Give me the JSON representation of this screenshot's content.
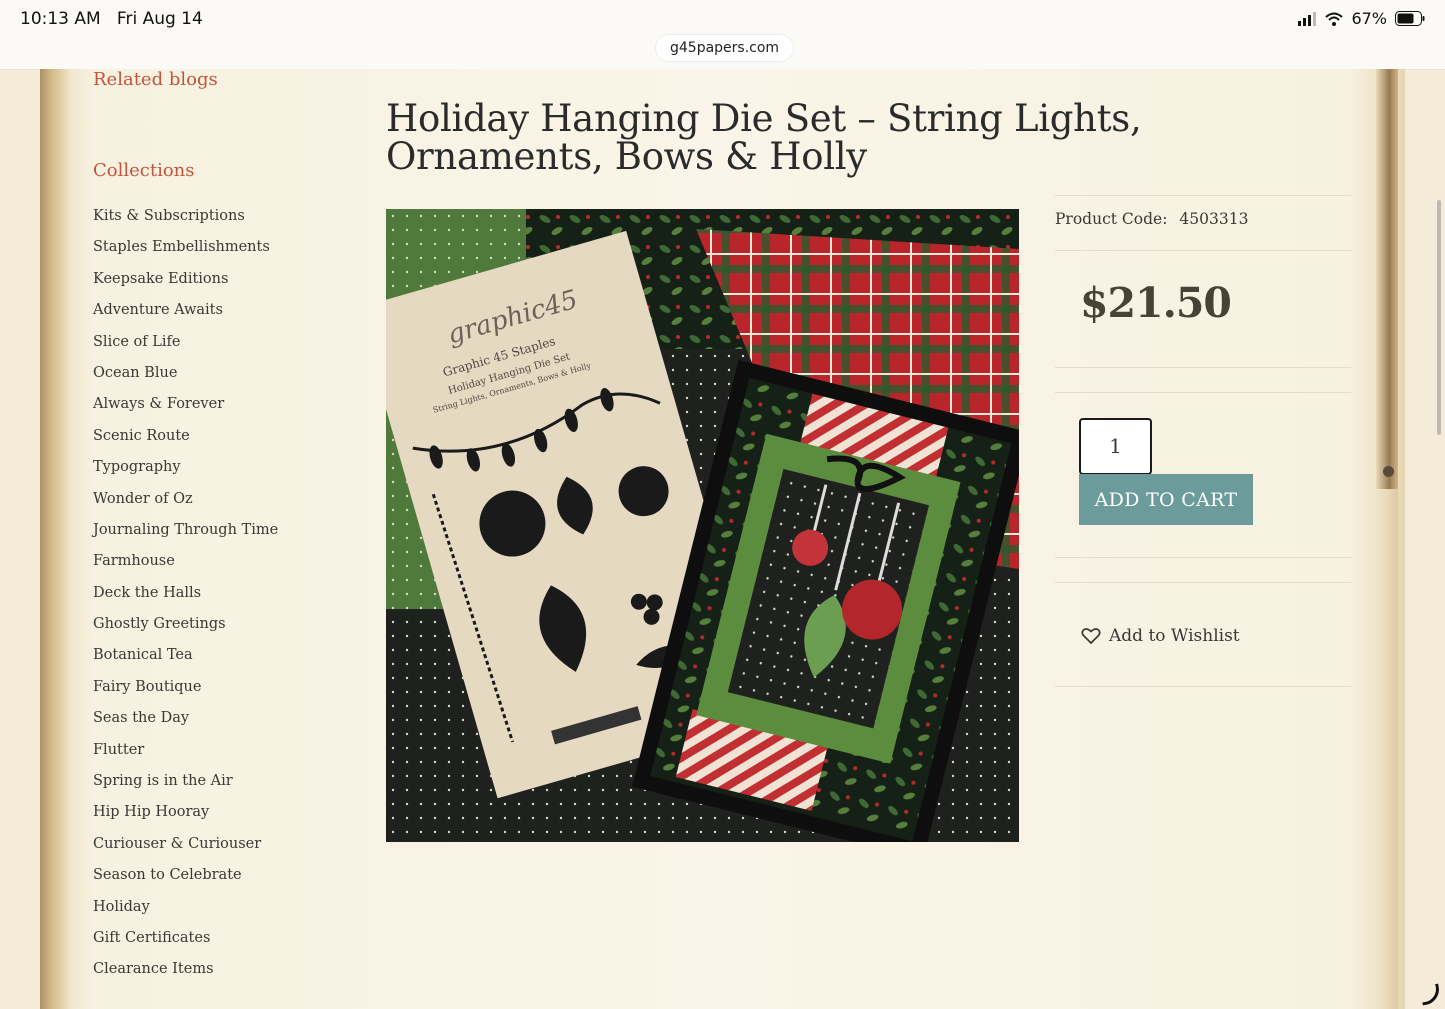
{
  "status_bar": {
    "time": "10:13 AM",
    "date": "Fri Aug 14",
    "battery": "67%",
    "url": "g45papers.com"
  },
  "sidebar": {
    "related_blogs": "Related blogs",
    "collections_heading": "Collections",
    "collections": [
      "Kits & Subscriptions",
      "Staples Embellishments",
      "Keepsake Editions",
      "Adventure Awaits",
      "Slice of Life",
      "Ocean Blue",
      "Always & Forever",
      "Scenic Route",
      "Typography",
      "Wonder of Oz",
      "Journaling Through Time",
      "Farmhouse",
      "Deck the Halls",
      "Ghostly Greetings",
      "Botanical Tea",
      "Fairy Boutique",
      "Seas the Day",
      "Flutter",
      "Spring is in the Air",
      "Hip Hip Hooray",
      "Curiouser & Curiouser",
      "Season to Celebrate",
      "Holiday",
      "Gift Certificates",
      "Clearance Items"
    ]
  },
  "product": {
    "title": "Holiday Hanging Die Set – String Lights, Ornaments, Bows & Holly",
    "code_label": "Product Code:",
    "code": "4503313",
    "price": "$21.50",
    "quantity": "1",
    "add_to_cart": "ADD TO CART",
    "wishlist": "Add to Wishlist",
    "image": {
      "brand": "graphic45",
      "line1": "Graphic 45 Staples",
      "line2": "Holiday Hanging Die Set",
      "line3": "String Lights, Ornaments, Bows & Holly"
    }
  },
  "colors": {
    "accent": "#c4553a",
    "button": "#6b9b9b",
    "price": "#474136"
  }
}
